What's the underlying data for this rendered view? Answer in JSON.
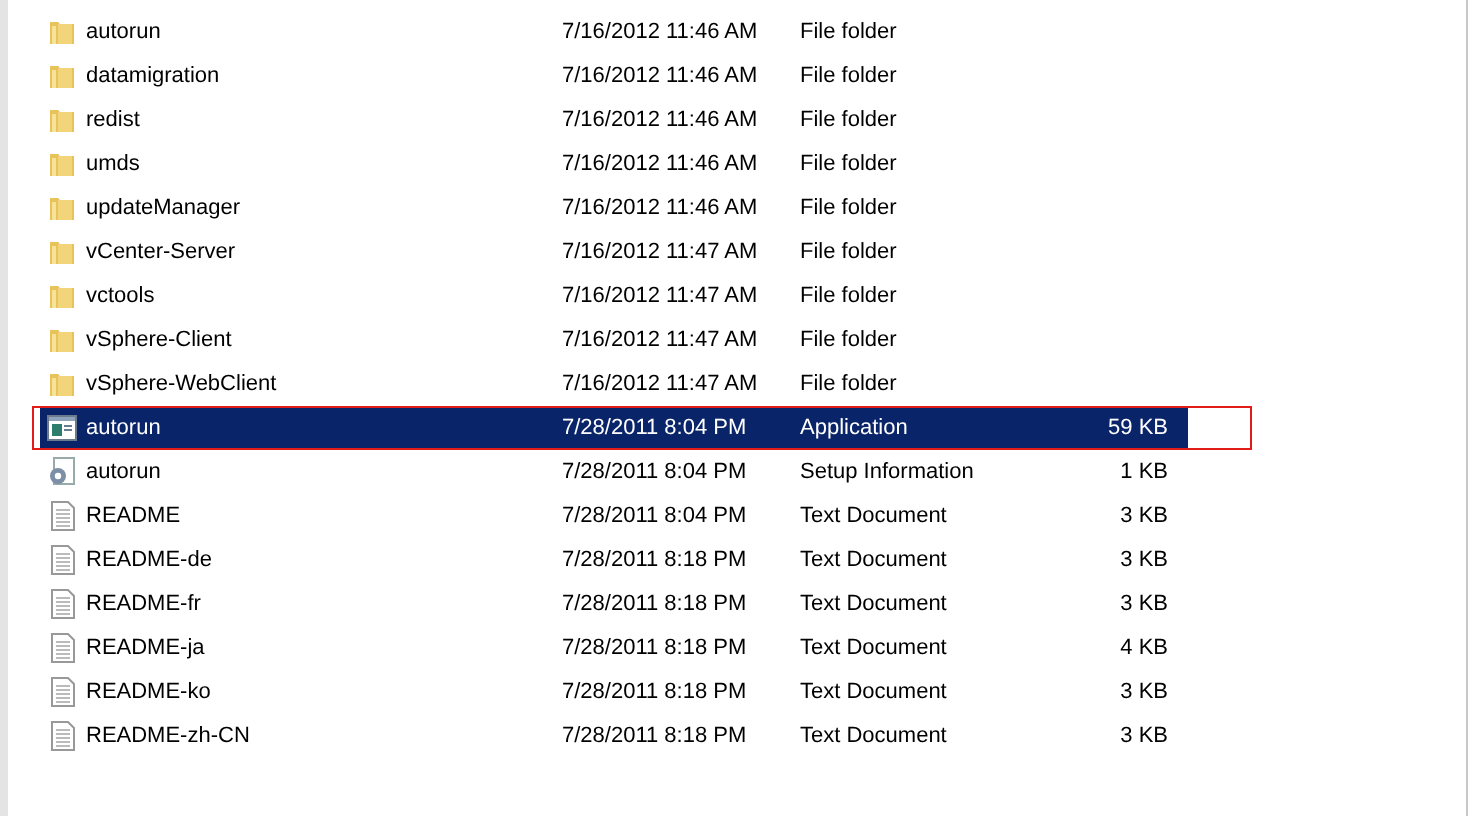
{
  "files": [
    {
      "kind": "folder",
      "name": "autorun",
      "date": "7/16/2012 11:46 AM",
      "type": "File folder",
      "selected": false,
      "outlined": false
    },
    {
      "kind": "folder",
      "name": "datamigration",
      "date": "7/16/2012 11:46 AM",
      "type": "File folder",
      "selected": false,
      "outlined": false
    },
    {
      "kind": "folder",
      "name": "redist",
      "date": "7/16/2012 11:46 AM",
      "type": "File folder",
      "selected": false,
      "outlined": false
    },
    {
      "kind": "folder",
      "name": "umds",
      "date": "7/16/2012 11:46 AM",
      "type": "File folder",
      "selected": false,
      "outlined": false
    },
    {
      "kind": "folder",
      "name": "updateManager",
      "date": "7/16/2012 11:46 AM",
      "type": "File folder",
      "selected": false,
      "outlined": false
    },
    {
      "kind": "folder",
      "name": "vCenter-Server",
      "date": "7/16/2012 11:47 AM",
      "type": "File folder",
      "selected": false,
      "outlined": false
    },
    {
      "kind": "folder",
      "name": "vctools",
      "date": "7/16/2012 11:47 AM",
      "type": "File folder",
      "selected": false,
      "outlined": false
    },
    {
      "kind": "folder",
      "name": "vSphere-Client",
      "date": "7/16/2012 11:47 AM",
      "type": "File folder",
      "selected": false,
      "outlined": false
    },
    {
      "kind": "folder",
      "name": "vSphere-WebClient",
      "date": "7/16/2012 11:47 AM",
      "type": "File folder",
      "selected": false,
      "outlined": false
    },
    {
      "kind": "application",
      "name": "autorun",
      "date": "7/28/2011 8:04 PM",
      "type": "Application",
      "size": "59 KB",
      "selected": true,
      "outlined": true
    },
    {
      "kind": "setup",
      "name": "autorun",
      "date": "7/28/2011 8:04 PM",
      "type": "Setup Information",
      "size": "1 KB",
      "selected": false,
      "outlined": false
    },
    {
      "kind": "text",
      "name": "README",
      "date": "7/28/2011 8:04 PM",
      "type": "Text Document",
      "size": "3 KB",
      "selected": false,
      "outlined": false
    },
    {
      "kind": "text",
      "name": "README-de",
      "date": "7/28/2011 8:18 PM",
      "type": "Text Document",
      "size": "3 KB",
      "selected": false,
      "outlined": false
    },
    {
      "kind": "text",
      "name": "README-fr",
      "date": "7/28/2011 8:18 PM",
      "type": "Text Document",
      "size": "3 KB",
      "selected": false,
      "outlined": false
    },
    {
      "kind": "text",
      "name": "README-ja",
      "date": "7/28/2011 8:18 PM",
      "type": "Text Document",
      "size": "4 KB",
      "selected": false,
      "outlined": false
    },
    {
      "kind": "text",
      "name": "README-ko",
      "date": "7/28/2011 8:18 PM",
      "type": "Text Document",
      "size": "3 KB",
      "selected": false,
      "outlined": false
    },
    {
      "kind": "text",
      "name": "README-zh-CN",
      "date": "7/28/2011 8:18 PM",
      "type": "Text Document",
      "size": "3 KB",
      "selected": false,
      "outlined": false
    }
  ]
}
